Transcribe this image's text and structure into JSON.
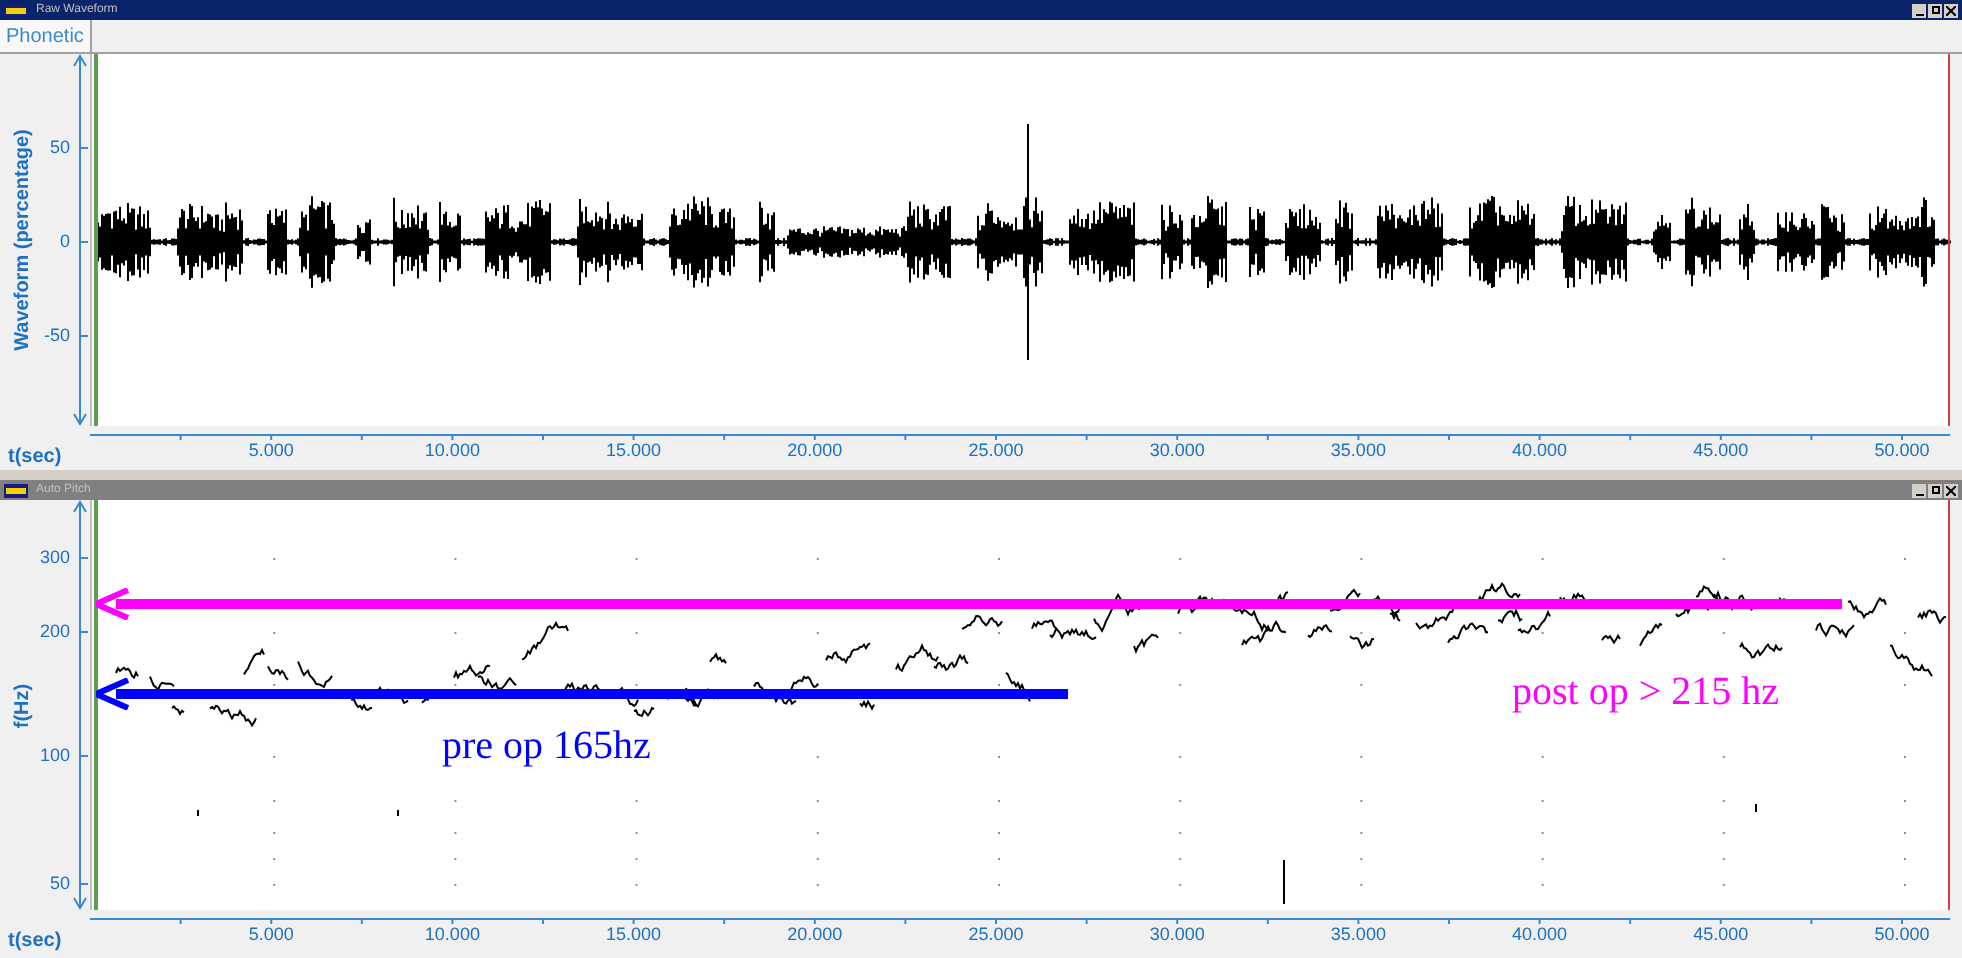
{
  "waveform_window": {
    "title": "Raw Waveform",
    "tab": "Phonetic",
    "y_axis_label": "Waveform (percentage)",
    "y_ticks": [
      "50",
      "0",
      "-50"
    ],
    "x_axis_label": "t(sec)",
    "x_ticks": [
      "5.000",
      "10.000",
      "15.000",
      "20.000",
      "25.000",
      "30.000",
      "35.000",
      "40.000",
      "45.000",
      "50.000"
    ]
  },
  "pitch_window": {
    "title": "Auto Pitch",
    "y_axis_label": "f(Hz)",
    "y_ticks": [
      "300",
      "200",
      "100",
      "50"
    ],
    "x_axis_label": "t(sec)",
    "x_ticks": [
      "5.000",
      "10.000",
      "15.000",
      "20.000",
      "25.000",
      "30.000",
      "35.000",
      "40.000",
      "45.000",
      "50.000"
    ],
    "annotations": [
      {
        "text": "pre op 165hz",
        "color": "#0000ff"
      },
      {
        "text": "post op > 215 hz",
        "color": "#ff00ff"
      }
    ]
  }
}
